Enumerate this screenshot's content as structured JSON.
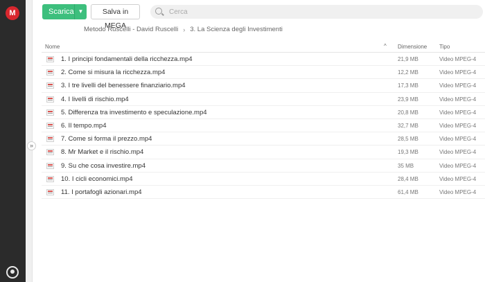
{
  "app": {
    "logo_letter": "M",
    "brand_color": "#d9272e",
    "accent_color": "#3dbf7d"
  },
  "toolbar": {
    "download_label": "Scarica",
    "download_menu_icon": "chevron-down-icon",
    "save_label": "Salva in MEGA"
  },
  "search": {
    "placeholder": "Cerca",
    "value": ""
  },
  "breadcrumb": {
    "items": [
      "Metodo Ruscelli - David Ruscelli",
      "3. La Scienza degli Investimenti"
    ],
    "separator": "›"
  },
  "table": {
    "columns": {
      "name": "Nome",
      "size": "Dimensione",
      "type": "Tipo",
      "sort_indicator": "^"
    },
    "rows": [
      {
        "name": "1. I principi fondamentali della ricchezza.mp4",
        "size": "21,9 MB",
        "type": "Video MPEG-4"
      },
      {
        "name": "2. Come si misura la ricchezza.mp4",
        "size": "12,2 MB",
        "type": "Video MPEG-4"
      },
      {
        "name": "3. I tre livelli del benessere finanziario.mp4",
        "size": "17,3 MB",
        "type": "Video MPEG-4"
      },
      {
        "name": "4. I livelli di rischio.mp4",
        "size": "23,9 MB",
        "type": "Video MPEG-4"
      },
      {
        "name": "5. Differenza tra investimento e speculazione.mp4",
        "size": "20,8 MB",
        "type": "Video MPEG-4"
      },
      {
        "name": "6. Il tempo.mp4",
        "size": "32,7 MB",
        "type": "Video MPEG-4"
      },
      {
        "name": "7. Come si forma il prezzo.mp4",
        "size": "28,5 MB",
        "type": "Video MPEG-4"
      },
      {
        "name": "8. Mr Market e il rischio.mp4",
        "size": "19,3 MB",
        "type": "Video MPEG-4"
      },
      {
        "name": "9. Su che cosa investire.mp4",
        "size": "35 MB",
        "type": "Video MPEG-4"
      },
      {
        "name": "10. I cicli economici.mp4",
        "size": "28,4 MB",
        "type": "Video MPEG-4"
      },
      {
        "name": "11. I portafogli azionari.mp4",
        "size": "61,4 MB",
        "type": "Video MPEG-4"
      }
    ]
  },
  "sidebar": {
    "collapse_icon": "double-chevron-right-icon",
    "bottom_icon": "account-icon"
  }
}
